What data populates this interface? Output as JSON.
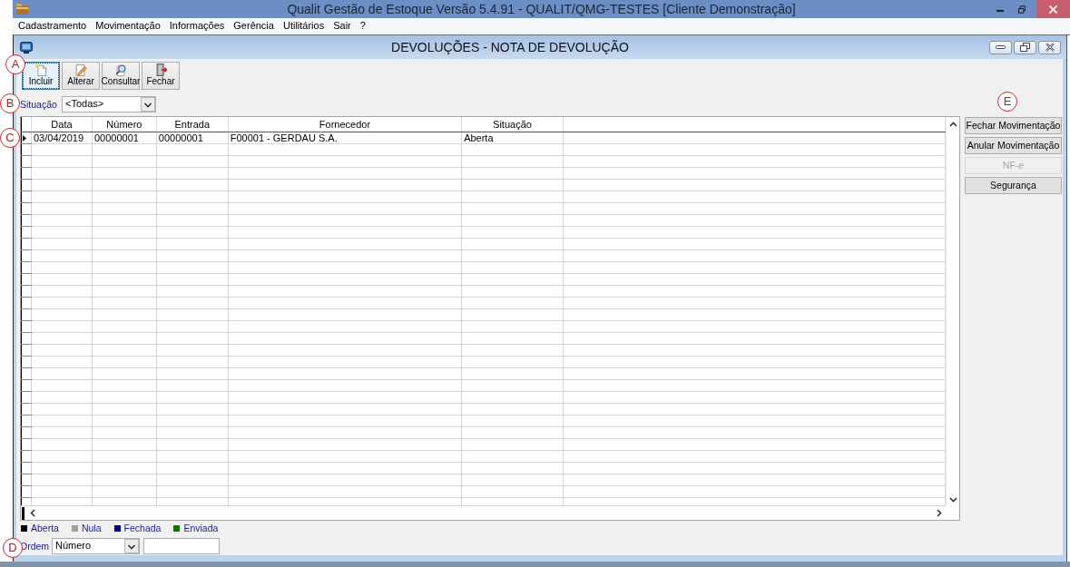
{
  "window": {
    "title": "Qualit Gestão de Estoque Versão 5.4.91 - QUALIT/QMG-TESTES [Cliente Demonstração]"
  },
  "menu": [
    {
      "label": "Cadastramento"
    },
    {
      "label": "Movimentação"
    },
    {
      "label": "Informações"
    },
    {
      "label": "Gerência"
    },
    {
      "label": "Utilitários"
    },
    {
      "label": "Sair"
    },
    {
      "label": "?"
    }
  ],
  "child_window": {
    "title": "DEVOLUÇÕES - NOTA DE DEVOLUÇÃO"
  },
  "toolbar": {
    "annotation": "A",
    "buttons": [
      {
        "kind": "new",
        "label": "Incluir",
        "focused": true
      },
      {
        "kind": "edit",
        "label": "Alterar",
        "focused": false
      },
      {
        "kind": "view",
        "label": "Consultar",
        "focused": false
      },
      {
        "kind": "exit",
        "label": "Fechar",
        "focused": false
      }
    ]
  },
  "filter": {
    "annotation": "B",
    "label": "Situação",
    "value": "<Todas>"
  },
  "grid": {
    "annotation": "C",
    "columns": [
      "Data",
      "Número",
      "Entrada",
      "Fornecedor",
      "Situação"
    ],
    "rows": [
      {
        "current": true,
        "cells": [
          "03/04/2019",
          "00000001",
          "00000001",
          "F00001 - GERDAU S.A.",
          "Aberta"
        ]
      }
    ]
  },
  "actions": {
    "annotation": "E",
    "buttons": [
      {
        "label": "Fechar Movimentação",
        "disabled": false
      },
      {
        "label": "Anular Movimentação",
        "disabled": false
      },
      {
        "label": "NF-e",
        "disabled": true
      },
      {
        "label": "Segurança",
        "disabled": false
      }
    ]
  },
  "legend": [
    {
      "label": "Aberta",
      "color": "#000000"
    },
    {
      "label": "Nula",
      "color": "#a0a0a0"
    },
    {
      "label": "Fechada",
      "color": "#000080"
    },
    {
      "label": "Enviada",
      "color": "#008000"
    }
  ],
  "order": {
    "annotation": "D",
    "label": "Ordem",
    "value": "Número"
  }
}
